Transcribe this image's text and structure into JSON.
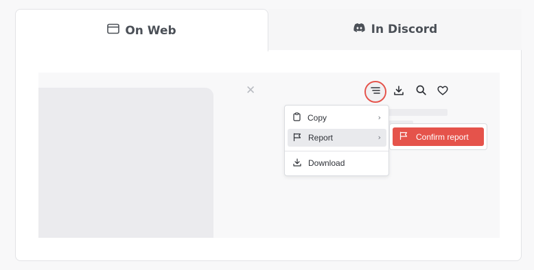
{
  "tabs": {
    "web_label": "On Web",
    "discord_label": "In Discord",
    "web_icon": "browser-window-icon",
    "discord_icon": "discord-icon"
  },
  "preview": {
    "close_icon": "close-icon",
    "toolbar_icons": [
      "menu-icon",
      "download-icon",
      "search-icon",
      "heart-icon"
    ]
  },
  "menu": {
    "copy_label": "Copy",
    "report_label": "Report",
    "download_label": "Download"
  },
  "submenu": {
    "confirm_label": "Confirm report"
  },
  "colors": {
    "accent_red": "#e5534b",
    "highlight_bg": "#e9eaed",
    "border": "#e2e3e6"
  }
}
